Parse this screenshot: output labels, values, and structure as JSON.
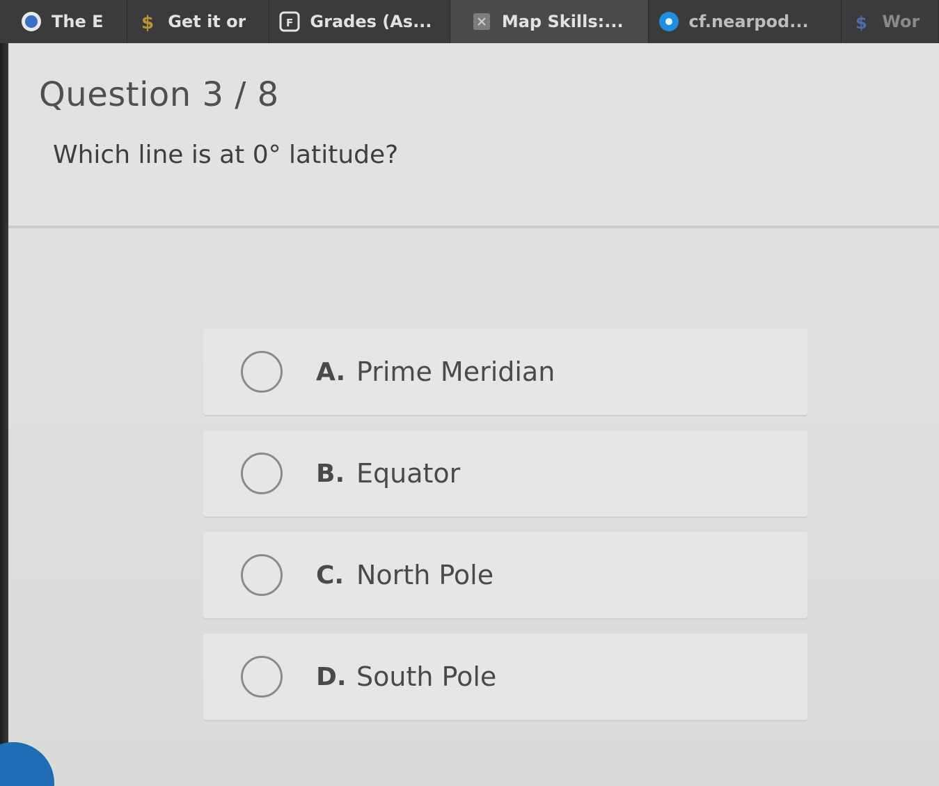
{
  "tabs": [
    {
      "label": "The E",
      "icon": "blue-circle-icon"
    },
    {
      "label": "Get it or",
      "icon": "dollar-icon"
    },
    {
      "label": "Grades (As...",
      "icon": "f-box-icon"
    },
    {
      "label": "Map Skills:...",
      "icon": "x-box-icon"
    },
    {
      "label": "cf.nearpod...",
      "icon": "blue-circle-icon"
    },
    {
      "label": "Wor",
      "icon": "dollar-icon"
    }
  ],
  "question": {
    "number": "Question 3 / 8",
    "text": "Which line is at 0° latitude?"
  },
  "options": [
    {
      "letter": "A.",
      "text": "Prime Meridian"
    },
    {
      "letter": "B.",
      "text": "Equator"
    },
    {
      "letter": "C.",
      "text": "North Pole"
    },
    {
      "letter": "D.",
      "text": "South Pole"
    }
  ],
  "colors": {
    "tabbar": "#3b3b3d",
    "accent": "#1e6db4",
    "option_bg": "#e6e6e4"
  }
}
